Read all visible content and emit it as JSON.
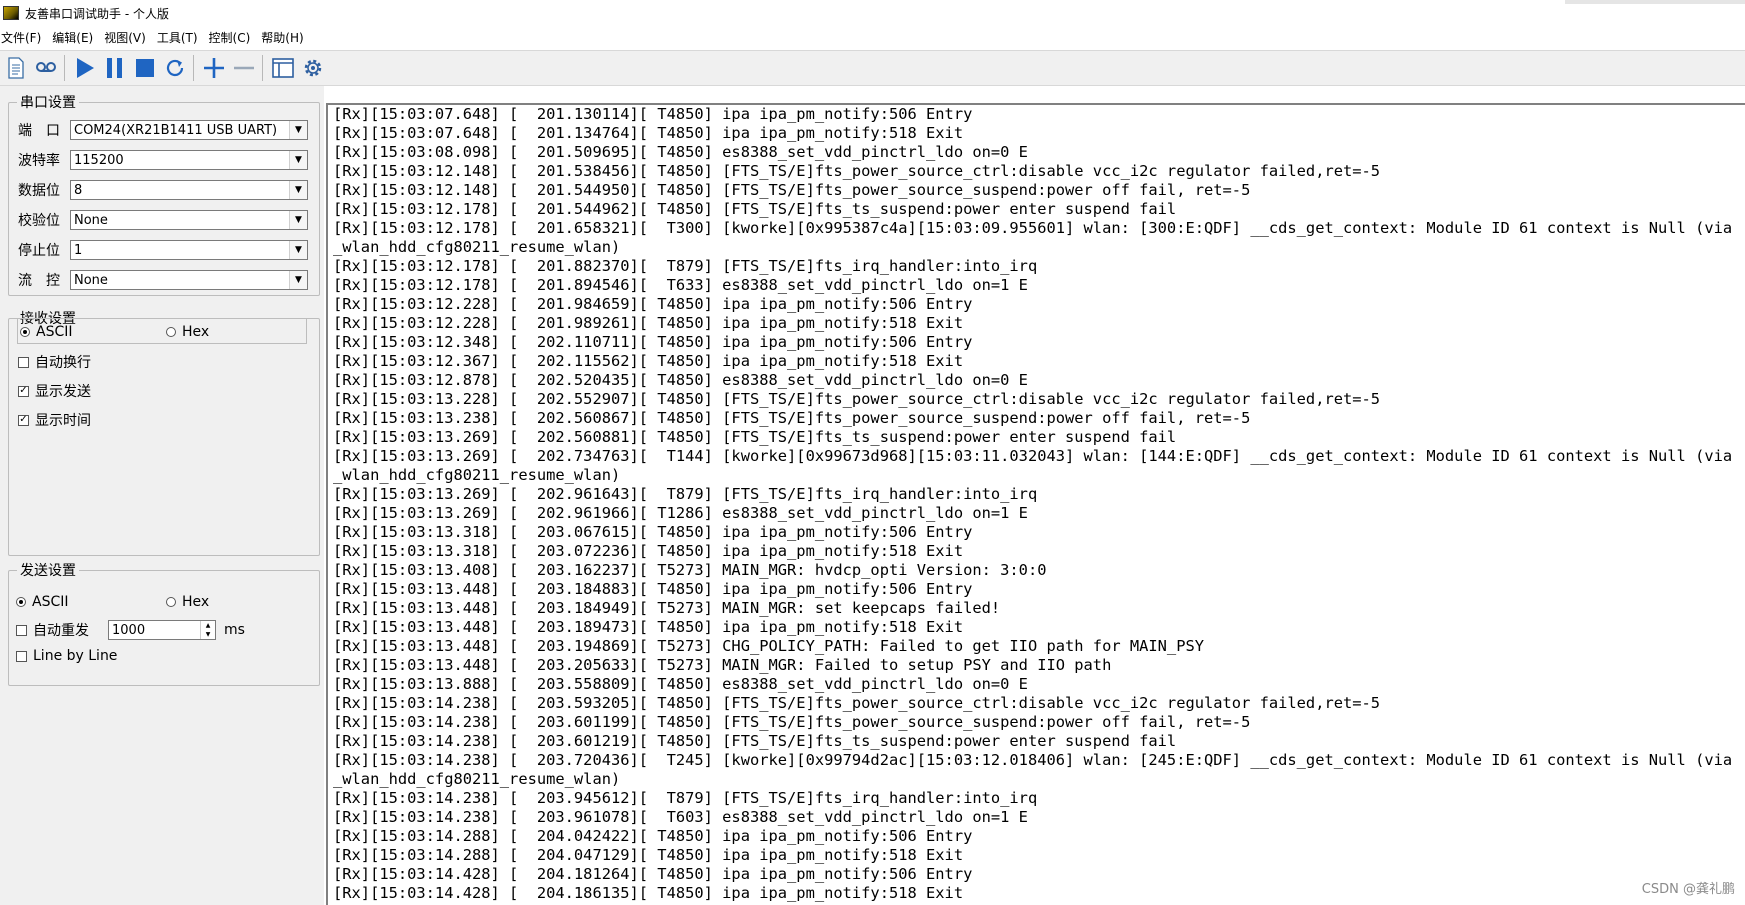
{
  "window": {
    "title": "友善串口调试助手 - 个人版"
  },
  "menu": [
    "文件(F)",
    "编辑(E)",
    "视图(V)",
    "工具(T)",
    "控制(C)",
    "帮助(H)"
  ],
  "toolbar_icons": [
    "new-document-icon",
    "loop-record-icon",
    "play-icon",
    "pause-icon",
    "stop-icon",
    "refresh-icon",
    "add-icon",
    "remove-icon",
    "window-layout-icon",
    "settings-gear-icon"
  ],
  "serial": {
    "legend": "串口设置",
    "port_label": "端　口",
    "port_value": "COM24(XR21B1411 USB UART)",
    "baud_label": "波特率",
    "baud_value": "115200",
    "databits_label": "数据位",
    "databits_value": "8",
    "parity_label": "校验位",
    "parity_value": "None",
    "stopbits_label": "停止位",
    "stopbits_value": "1",
    "flow_label": "流　控",
    "flow_value": "None"
  },
  "receive": {
    "legend": "接收设置",
    "ascii": "ASCII",
    "hex": "Hex",
    "auto_wrap": "自动换行",
    "show_send": "显示发送",
    "show_time": "显示时间"
  },
  "send": {
    "legend": "发送设置",
    "ascii": "ASCII",
    "hex": "Hex",
    "auto_resend": "自动重发",
    "interval_value": "1000",
    "interval_unit": "ms",
    "line_by_line": "Line by Line"
  },
  "log": [
    "[Rx][15:03:07.648] [  201.130114][ T4850] ipa ipa_pm_notify:506 Entry",
    "[Rx][15:03:07.648] [  201.134764][ T4850] ipa ipa_pm_notify:518 Exit",
    "[Rx][15:03:08.098] [  201.509695][ T4850] es8388_set_vdd_pinctrl_ldo on=0 E",
    "[Rx][15:03:12.148] [  201.538456][ T4850] [FTS_TS/E]fts_power_source_ctrl:disable vcc_i2c regulator failed,ret=-5",
    "[Rx][15:03:12.148] [  201.544950][ T4850] [FTS_TS/E]fts_power_source_suspend:power off fail, ret=-5",
    "[Rx][15:03:12.178] [  201.544962][ T4850] [FTS_TS/E]fts_ts_suspend:power enter suspend fail",
    "[Rx][15:03:12.178] [  201.658321][  T300] [kworke][0x995387c4a][15:03:09.955601] wlan: [300:E:QDF] __cds_get_context: Module ID 61 context is Null (via",
    "_wlan_hdd_cfg80211_resume_wlan)",
    "[Rx][15:03:12.178] [  201.882370][  T879] [FTS_TS/E]fts_irq_handler:into_irq",
    "[Rx][15:03:12.178] [  201.894546][  T633] es8388_set_vdd_pinctrl_ldo on=1 E",
    "[Rx][15:03:12.228] [  201.984659][ T4850] ipa ipa_pm_notify:506 Entry",
    "[Rx][15:03:12.228] [  201.989261][ T4850] ipa ipa_pm_notify:518 Exit",
    "[Rx][15:03:12.348] [  202.110711][ T4850] ipa ipa_pm_notify:506 Entry",
    "[Rx][15:03:12.367] [  202.115562][ T4850] ipa ipa_pm_notify:518 Exit",
    "[Rx][15:03:12.878] [  202.520435][ T4850] es8388_set_vdd_pinctrl_ldo on=0 E",
    "[Rx][15:03:13.228] [  202.552907][ T4850] [FTS_TS/E]fts_power_source_ctrl:disable vcc_i2c regulator failed,ret=-5",
    "[Rx][15:03:13.238] [  202.560867][ T4850] [FTS_TS/E]fts_power_source_suspend:power off fail, ret=-5",
    "[Rx][15:03:13.269] [  202.560881][ T4850] [FTS_TS/E]fts_ts_suspend:power enter suspend fail",
    "[Rx][15:03:13.269] [  202.734763][  T144] [kworke][0x99673d968][15:03:11.032043] wlan: [144:E:QDF] __cds_get_context: Module ID 61 context is Null (via",
    "_wlan_hdd_cfg80211_resume_wlan)",
    "[Rx][15:03:13.269] [  202.961643][  T879] [FTS_TS/E]fts_irq_handler:into_irq",
    "[Rx][15:03:13.269] [  202.961966][ T1286] es8388_set_vdd_pinctrl_ldo on=1 E",
    "[Rx][15:03:13.318] [  203.067615][ T4850] ipa ipa_pm_notify:506 Entry",
    "[Rx][15:03:13.318] [  203.072236][ T4850] ipa ipa_pm_notify:518 Exit",
    "[Rx][15:03:13.408] [  203.162237][ T5273] MAIN_MGR: hvdcp_opti Version: 3:0:0",
    "[Rx][15:03:13.448] [  203.184883][ T4850] ipa ipa_pm_notify:506 Entry",
    "[Rx][15:03:13.448] [  203.184949][ T5273] MAIN_MGR: set keepcaps failed!",
    "[Rx][15:03:13.448] [  203.189473][ T4850] ipa ipa_pm_notify:518 Exit",
    "[Rx][15:03:13.448] [  203.194869][ T5273] CHG_POLICY_PATH: Failed to get IIO path for MAIN_PSY",
    "[Rx][15:03:13.448] [  203.205633][ T5273] MAIN_MGR: Failed to setup PSY and IIO path",
    "[Rx][15:03:13.888] [  203.558809][ T4850] es8388_set_vdd_pinctrl_ldo on=0 E",
    "[Rx][15:03:14.238] [  203.593205][ T4850] [FTS_TS/E]fts_power_source_ctrl:disable vcc_i2c regulator failed,ret=-5",
    "[Rx][15:03:14.238] [  203.601199][ T4850] [FTS_TS/E]fts_power_source_suspend:power off fail, ret=-5",
    "[Rx][15:03:14.238] [  203.601219][ T4850] [FTS_TS/E]fts_ts_suspend:power enter suspend fail",
    "[Rx][15:03:14.238] [  203.720436][  T245] [kworke][0x99794d2ac][15:03:12.018406] wlan: [245:E:QDF] __cds_get_context: Module ID 61 context is Null (via",
    "_wlan_hdd_cfg80211_resume_wlan)",
    "[Rx][15:03:14.238] [  203.945612][  T879] [FTS_TS/E]fts_irq_handler:into_irq",
    "[Rx][15:03:14.238] [  203.961078][  T603] es8388_set_vdd_pinctrl_ldo on=1 E",
    "[Rx][15:03:14.288] [  204.042422][ T4850] ipa ipa_pm_notify:506 Entry",
    "[Rx][15:03:14.288] [  204.047129][ T4850] ipa ipa_pm_notify:518 Exit",
    "[Rx][15:03:14.428] [  204.181264][ T4850] ipa ipa_pm_notify:506 Entry",
    "[Rx][15:03:14.428] [  204.186135][ T4850] ipa ipa_pm_notify:518 Exit"
  ],
  "watermark": "CSDN @龚礼鹏"
}
